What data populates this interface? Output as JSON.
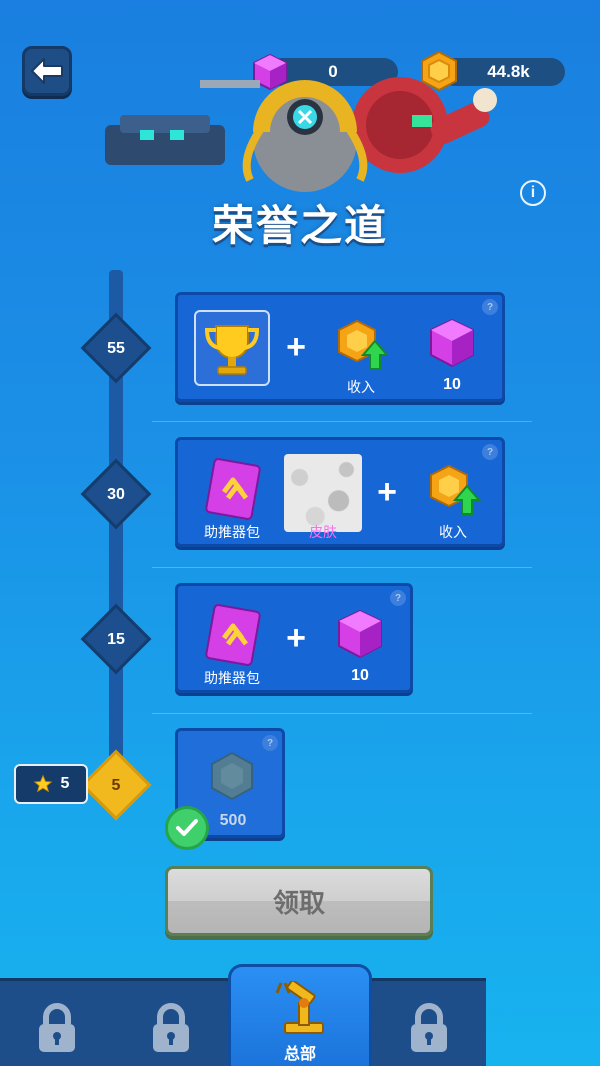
{
  "header": {
    "gems": "0",
    "coins": "44.8k",
    "title": "荣誉之道",
    "info_symbol": "i"
  },
  "tiers": [
    {
      "level": "55",
      "rewards": [
        {
          "icon": "trophy-icon",
          "caption": ""
        },
        {
          "icon": "coin-income-icon",
          "caption": "收入"
        },
        {
          "icon": "gem-icon",
          "caption": "10"
        }
      ]
    },
    {
      "level": "30",
      "rewards": [
        {
          "icon": "booster-pack-icon",
          "caption": "助推器包"
        },
        {
          "icon": "skin-icon",
          "caption": "皮肤"
        },
        {
          "icon": "coin-income-icon",
          "caption": "收入"
        }
      ]
    },
    {
      "level": "15",
      "rewards": [
        {
          "icon": "booster-pack-icon",
          "caption": "助推器包"
        },
        {
          "icon": "gem-icon",
          "caption": "10"
        }
      ]
    },
    {
      "level": "5",
      "rewards": [
        {
          "icon": "coin-icon",
          "caption": "500"
        }
      ]
    }
  ],
  "card_help": "?",
  "plus_sign": "+",
  "player": {
    "stars": "5"
  },
  "claim_button": "领取",
  "nav": {
    "active_label": "总部"
  },
  "colors": {
    "accent": "#1766d6",
    "current_level": "#f2b91f",
    "claimed": "#3fd06b"
  }
}
